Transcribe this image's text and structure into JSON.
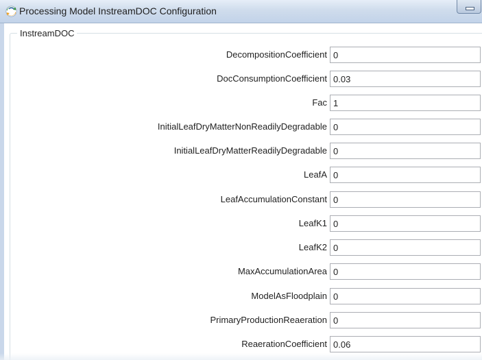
{
  "window": {
    "title": "Processing Model InstreamDOC Configuration",
    "app_icon": "sync-logo-icon",
    "minimize_icon": "minimize-icon"
  },
  "group": {
    "label": "InstreamDOC"
  },
  "fields": [
    {
      "label": "DecompositionCoefficient",
      "value": "0"
    },
    {
      "label": "DocConsumptionCoefficient",
      "value": "0.03"
    },
    {
      "label": "Fac",
      "value": "1"
    },
    {
      "label": "InitialLeafDryMatterNonReadilyDegradable",
      "value": "0"
    },
    {
      "label": "InitialLeafDryMatterReadilyDegradable",
      "value": "0"
    },
    {
      "label": "LeafA",
      "value": "0"
    },
    {
      "label": "LeafAccumulationConstant",
      "value": "0"
    },
    {
      "label": "LeafK1",
      "value": "0"
    },
    {
      "label": "LeafK2",
      "value": "0"
    },
    {
      "label": "MaxAccumulationArea",
      "value": "0"
    },
    {
      "label": "ModelAsFloodplain",
      "value": "0"
    },
    {
      "label": "PrimaryProductionReaeration",
      "value": "0"
    },
    {
      "label": "ReaerationCoefficient",
      "value": "0.06"
    }
  ]
}
